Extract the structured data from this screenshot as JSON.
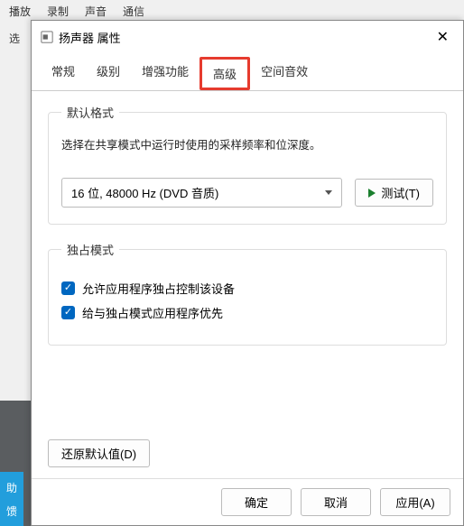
{
  "background": {
    "tabs": [
      "播放",
      "录制",
      "声音",
      "通信"
    ],
    "selectLabel": "选",
    "helpWord": "助",
    "feedbackWord": "馈"
  },
  "dialog": {
    "title": "扬声器 属性",
    "tabs": {
      "general": "常规",
      "levels": "级别",
      "enhance": "增强功能",
      "advanced": "高级",
      "spatial": "空间音效"
    },
    "defaultFormat": {
      "legend": "默认格式",
      "desc": "选择在共享模式中运行时使用的采样频率和位深度。",
      "selected": "16 位, 48000 Hz (DVD 音质)",
      "testBtn": "测试(T)"
    },
    "exclusive": {
      "legend": "独占模式",
      "opt1": "允许应用程序独占控制该设备",
      "opt2": "给与独占模式应用程序优先"
    },
    "restoreBtn": "还原默认值(D)",
    "footer": {
      "ok": "确定",
      "cancel": "取消",
      "apply": "应用(A)"
    }
  }
}
